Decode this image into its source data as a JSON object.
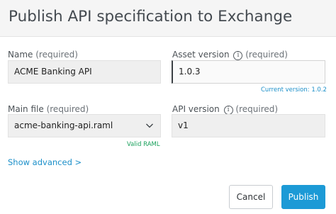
{
  "dialog": {
    "title": "Publish API specification to Exchange"
  },
  "form": {
    "name": {
      "label": "Name",
      "required": "(required)",
      "value": "ACME Banking API"
    },
    "asset_version": {
      "label": "Asset version",
      "required": "(required)",
      "value": "1.0.3",
      "hint": "Current version: 1.0.2",
      "icon": "info-icon"
    },
    "main_file": {
      "label": "Main file",
      "required": "(required)",
      "value": "acme-banking-api.raml",
      "validation": "Valid RAML",
      "icon": "chevron-down-icon"
    },
    "api_version": {
      "label": "API version",
      "required": "(required)",
      "value": "v1",
      "icon": "info-icon"
    }
  },
  "advanced": {
    "label": "Show advanced >"
  },
  "actions": {
    "cancel_label": "Cancel",
    "publish_label": "Publish"
  },
  "colors": {
    "accent": "#1c9ad6",
    "valid": "#19a05b"
  }
}
